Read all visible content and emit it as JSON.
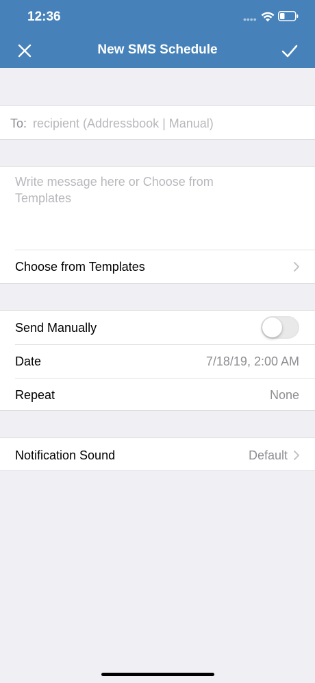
{
  "status_bar": {
    "time": "12:36",
    "signal_dots": "••••"
  },
  "nav": {
    "title": "New SMS Schedule"
  },
  "recipient": {
    "label": "To:",
    "placeholder": "recipient (Addressbook | Manual)",
    "value": ""
  },
  "message": {
    "placeholder": "Write message here or Choose from Templates",
    "value": ""
  },
  "templates": {
    "label": "Choose from Templates"
  },
  "schedule": {
    "send_manually": {
      "label": "Send Manually",
      "enabled": false
    },
    "date": {
      "label": "Date",
      "value": "7/18/19, 2:00 AM"
    },
    "repeat": {
      "label": "Repeat",
      "value": "None"
    }
  },
  "notification": {
    "label": "Notification Sound",
    "value": "Default"
  },
  "colors": {
    "header": "#4682b9",
    "background": "#efeff4"
  }
}
